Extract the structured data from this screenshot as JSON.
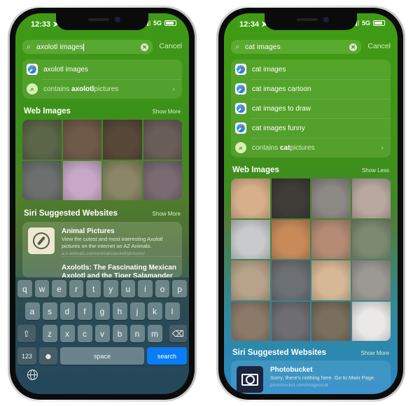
{
  "phones": [
    {
      "status": {
        "time": "12:33",
        "network": "5G",
        "location_icon": "location-arrow-icon"
      },
      "search": {
        "query": "axolotl images",
        "cancel_label": "Cancel"
      },
      "suggestions": [
        {
          "type": "safari",
          "icon": "safari-icon",
          "text": "axolotl images"
        },
        {
          "type": "contains",
          "icon": "search-icon",
          "prefix": "contains ",
          "bold": "axolotl",
          "suffix": " pictures",
          "chevron": "›"
        }
      ],
      "web_images": {
        "title": "Web Images",
        "toggle_label": "Show More",
        "images": [
          {
            "desc": "axolotl on gravel",
            "color": "#5b6548"
          },
          {
            "desc": "brown axolotl",
            "color": "#6f5a4a"
          },
          {
            "desc": "dark axolotl near rock",
            "color": "#584838"
          },
          {
            "desc": "axolotl among plants",
            "color": "#6a5e58"
          },
          {
            "desc": "grey axolotl on sand",
            "color": "#6b6f6e"
          },
          {
            "desc": "pink leucistic axolotl",
            "color": "#c8a8c8"
          },
          {
            "desc": "tan axolotl",
            "color": "#8a8766"
          },
          {
            "desc": "purple axolotl",
            "color": "#7a6a72"
          }
        ]
      },
      "siri_websites": {
        "title": "Siri Suggested Websites",
        "toggle_label": "Show More",
        "items": [
          {
            "title": "Animal Pictures",
            "description": "View the cutest and most interesting Axolotl pictures on the internet on AZ Animals.",
            "url": "a-z-animals.com/animals/axolotl/pictures/"
          },
          {
            "title": "Axolotls: The Fascinating Mexican Axolotl and the Tiger Salamander",
            "description": "",
            "url": ""
          }
        ]
      },
      "keyboard": {
        "row1": [
          "q",
          "w",
          "e",
          "r",
          "t",
          "y",
          "u",
          "i",
          "o",
          "p"
        ],
        "row2": [
          "a",
          "s",
          "d",
          "f",
          "g",
          "h",
          "j",
          "k",
          "l"
        ],
        "row3": [
          "z",
          "x",
          "c",
          "v",
          "b",
          "n",
          "m"
        ],
        "shift_icon": "⇧",
        "delete_icon": "⌫",
        "numbers_label": "123",
        "emoji_icon": "☻",
        "space_label": "space",
        "search_label": "search"
      }
    },
    {
      "status": {
        "time": "12:34",
        "network": "5G",
        "location_icon": "location-arrow-icon"
      },
      "search": {
        "query": "cat images",
        "cancel_label": "Cancel"
      },
      "suggestions": [
        {
          "type": "safari",
          "icon": "safari-icon",
          "text": "cat images"
        },
        {
          "type": "safari",
          "icon": "safari-icon",
          "text": "cat images cartoon"
        },
        {
          "type": "safari",
          "icon": "safari-icon",
          "text": "cat images to draw"
        },
        {
          "type": "safari",
          "icon": "safari-icon",
          "text": "cat images funny"
        },
        {
          "type": "contains",
          "icon": "search-icon",
          "prefix": "contains ",
          "bold": "cat",
          "suffix": " pictures",
          "chevron": "›"
        }
      ],
      "web_images": {
        "title": "Web Images",
        "toggle_label": "Show Less",
        "images": [
          {
            "desc": "orange and white cat",
            "color": "#d7b08a"
          },
          {
            "desc": "tabby cat on black",
            "color": "#3f3c38"
          },
          {
            "desc": "grey tabby lying",
            "color": "#8c8884"
          },
          {
            "desc": "two kittens",
            "color": "#b8a8a0"
          },
          {
            "desc": "grey and white kitten",
            "color": "#c8cacc"
          },
          {
            "desc": "fluffy ginger cat",
            "color": "#c98a5a"
          },
          {
            "desc": "tabby cat lying",
            "color": "#b48c74"
          },
          {
            "desc": "grey cat on green",
            "color": "#7d8a72"
          },
          {
            "desc": "tabby kitten",
            "color": "#b7a38a"
          },
          {
            "desc": "grey cat on sofa",
            "color": "#6c6f74"
          },
          {
            "desc": "ginger kitten on pillow",
            "color": "#d7b896"
          },
          {
            "desc": "silver tabby",
            "color": "#9c9894"
          },
          {
            "desc": "brown tabby",
            "color": "#8c7a68"
          },
          {
            "desc": "grey british shorthair",
            "color": "#6e6e72"
          },
          {
            "desc": "tabby close-up",
            "color": "#7a6e5e"
          },
          {
            "desc": "white cat",
            "color": "#ebe8e8"
          }
        ]
      },
      "siri_websites": {
        "title": "Siri Suggested Websites",
        "toggle_label": "Show More",
        "items": [
          {
            "title": "Photobucket",
            "description": "Sorry, there's nothing here. Go to Main Page.",
            "url": "photobucket.com/images/cat"
          }
        ]
      }
    }
  ]
}
